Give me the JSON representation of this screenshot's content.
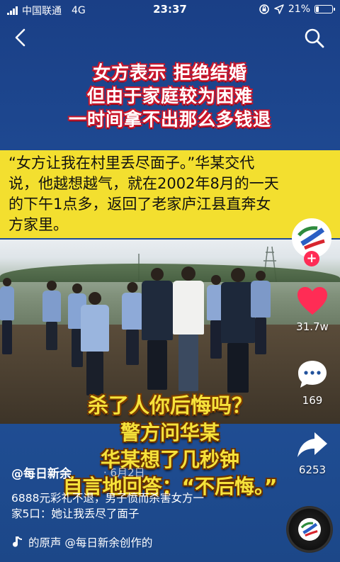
{
  "status_bar": {
    "carrier": "中国联通",
    "network": "4G",
    "time": "23:37",
    "battery": "21%",
    "battery_level": 0.21
  },
  "video": {
    "headline_lines": [
      "女方表示 拒绝结婚",
      "但由于家庭较为困难",
      "一时间拿不出那么多钱退"
    ],
    "quote_lines": [
      "“女方让我在村里丢尽面子。”华某交代",
      "说，他越想越气，就在2002年8月的一天",
      "的下午1点多，返回了老家庐江县直奔女",
      "方家里。"
    ],
    "overlay_question": "杀了人你后悔吗？",
    "overlay_lines": [
      "警方问华某",
      "华某想了几秒钟",
      "自言地回答：“不后悔。”"
    ]
  },
  "rail": {
    "follow": "+",
    "likes": "31.7w",
    "comments": "169",
    "shares": "6253"
  },
  "post": {
    "author": "@每日新余",
    "date": "· 6月2日",
    "caption_lines": [
      "6888元彩礼不退，男子愤而杀害女方一",
      "家5口：她让我丢尽了面子"
    ],
    "music": "的原声    @每日新余创作的"
  },
  "colors": {
    "headline_outline": "#c9162b",
    "quote_bg": "#f3df2f",
    "overlay_text": "#f6e23a",
    "like": "#ff2c55"
  }
}
